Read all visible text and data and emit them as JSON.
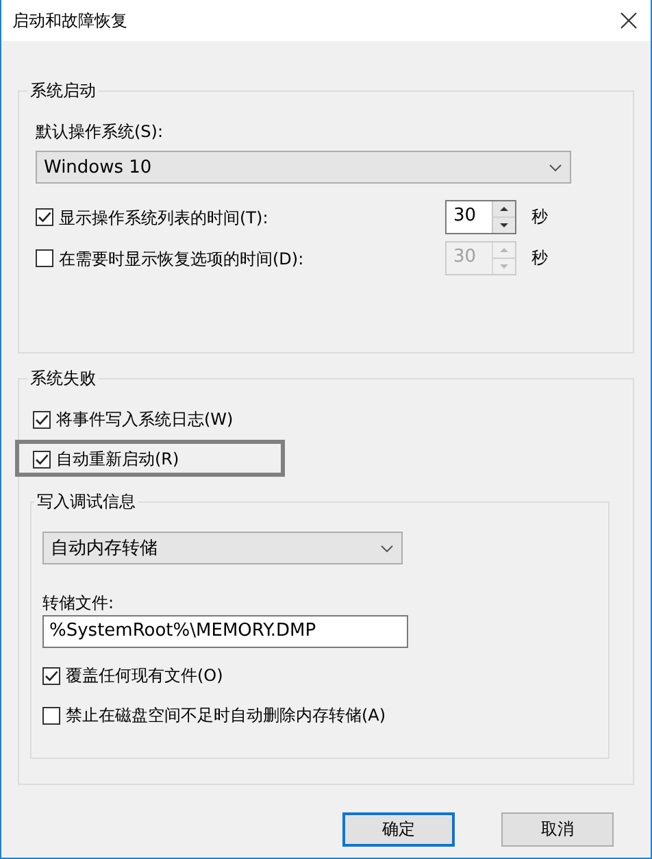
{
  "window": {
    "title": "启动和故障恢复"
  },
  "system_startup": {
    "title": "系统启动",
    "default_os_label": "默认操作系统(S):",
    "default_os": "Windows 10",
    "options": [
      {
        "label": "显示操作系统列表的时间(T):",
        "checked": true,
        "value": "30",
        "disabled": false,
        "unit": "秒"
      },
      {
        "label": "在需要时显示恢复选项的时间(D):",
        "checked": false,
        "value": "30",
        "disabled": true,
        "unit": "秒"
      }
    ]
  },
  "system_failure": {
    "title": "系统失败",
    "options": [
      {
        "label": "将事件写入系统日志(W)",
        "checked": true,
        "highlighted": false
      },
      {
        "label": "自动重新启动(R)",
        "checked": true,
        "highlighted": true
      }
    ],
    "debug_info": {
      "title": "写入调试信息",
      "dump_type": "自动内存转储",
      "dump_file_label": "转储文件:",
      "dump_file": "%SystemRoot%\\MEMORY.DMP",
      "options": [
        {
          "label": "覆盖任何现有文件(O)",
          "checked": true
        },
        {
          "label": "禁止在磁盘空间不足时自动删除内存转储(A)",
          "checked": false
        }
      ]
    }
  },
  "buttons": [
    {
      "label": "确定",
      "default": true
    },
    {
      "label": "取消",
      "default": false
    }
  ]
}
